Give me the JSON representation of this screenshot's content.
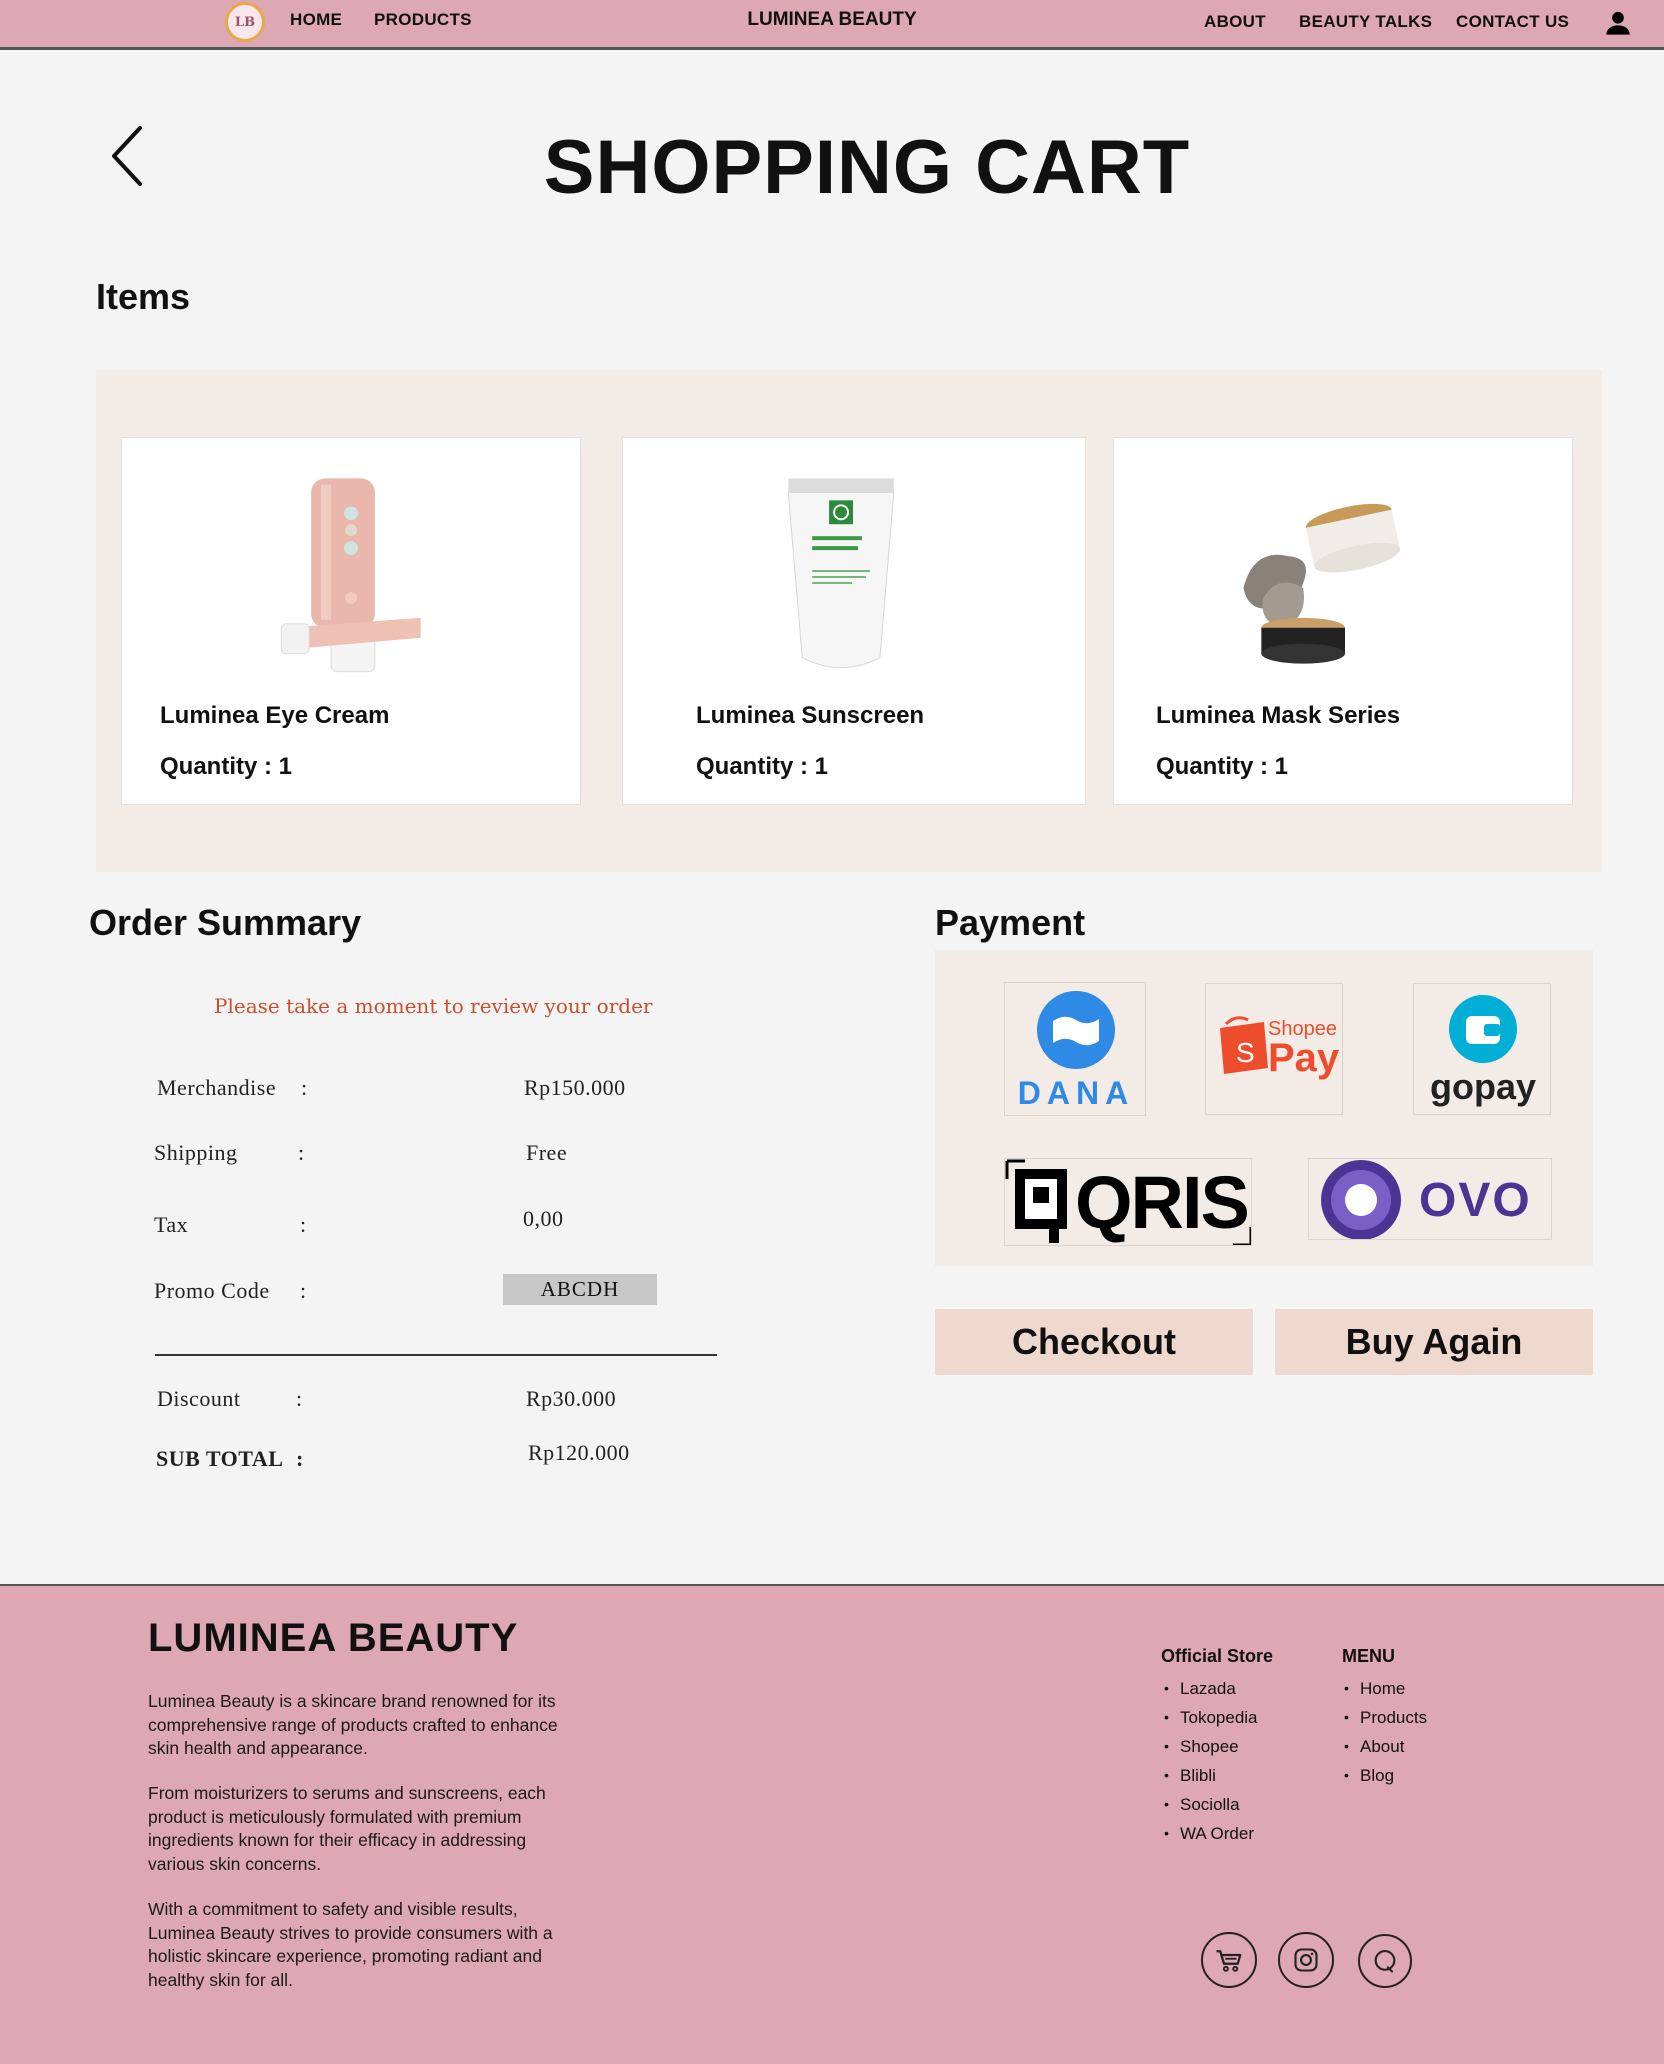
{
  "nav": {
    "logo_text": "LB",
    "home": "HOME",
    "products": "PRODUCTS",
    "brand": "LUMINEA BEAUTY",
    "about": "ABOUT",
    "beauty_talks": "BEAUTY TALKS",
    "contact_us": "CONTACT US"
  },
  "page": {
    "title": "SHOPPING CART",
    "items_heading": "Items",
    "order_summary_heading": "Order Summary",
    "payment_heading": "Payment"
  },
  "items": [
    {
      "name": "Luminea Eye Cream",
      "quantity": "Quantity : 1"
    },
    {
      "name": "Luminea Sunscreen",
      "quantity": "Quantity : 1"
    },
    {
      "name": "Luminea Mask Series",
      "quantity": "Quantity : 1"
    }
  ],
  "summary": {
    "note": "Please take a moment to review your order",
    "colon": ":",
    "merchandise_label": "Merchandise",
    "merchandise_value": "Rp150.000",
    "shipping_label": "Shipping",
    "shipping_value": "Free",
    "tax_label": "Tax",
    "tax_value": "0,00",
    "promo_label": "Promo Code",
    "promo_value": "ABCDH",
    "discount_label": "Discount",
    "discount_value": "Rp30.000",
    "subtotal_label": "SUB TOTAL",
    "subtotal_value": "Rp120.000"
  },
  "payment": {
    "dana": "DANA",
    "shopee_top": "Shopee",
    "shopee_bottom": "Pay",
    "gopay": "gopay",
    "qris": "QRIS",
    "ovo": "OVO"
  },
  "buttons": {
    "checkout": "Checkout",
    "buy_again": "Buy Again"
  },
  "footer": {
    "brand": "LUMINEA BEAUTY",
    "para1": "Luminea Beauty is a skincare brand renowned for its comprehensive range of products crafted to enhance skin health and appearance.",
    "para2": "From moisturizers to serums and sunscreens, each product is meticulously formulated with premium ingredients known for their efficacy in addressing various skin concerns.",
    "para3": "With a commitment to safety and visible results, Luminea Beauty strives to provide consumers with a holistic skincare experience, promoting radiant and healthy skin for all.",
    "official_store_heading": "Official Store",
    "stores": [
      "Lazada",
      "Tokopedia",
      "Shopee",
      "Blibli",
      "Sociolla",
      "WA Order"
    ],
    "menu_heading": "MENU",
    "menu": [
      "Home",
      "Products",
      "About",
      "Blog"
    ]
  },
  "colors": {
    "nav_pink": "#dda7b3",
    "panel_beige": "#f3ece6",
    "button_peach": "#efd9ce",
    "note_orange": "#c8502e",
    "dana_blue": "#2f8ae5",
    "shopee_orange": "#ee4d2d",
    "gopay_blue": "#00aed6",
    "ovo_purple": "#4c3494"
  },
  "icons": [
    "user-icon",
    "back-arrow-icon",
    "cart-icon",
    "instagram-icon",
    "whatsapp-icon"
  ]
}
